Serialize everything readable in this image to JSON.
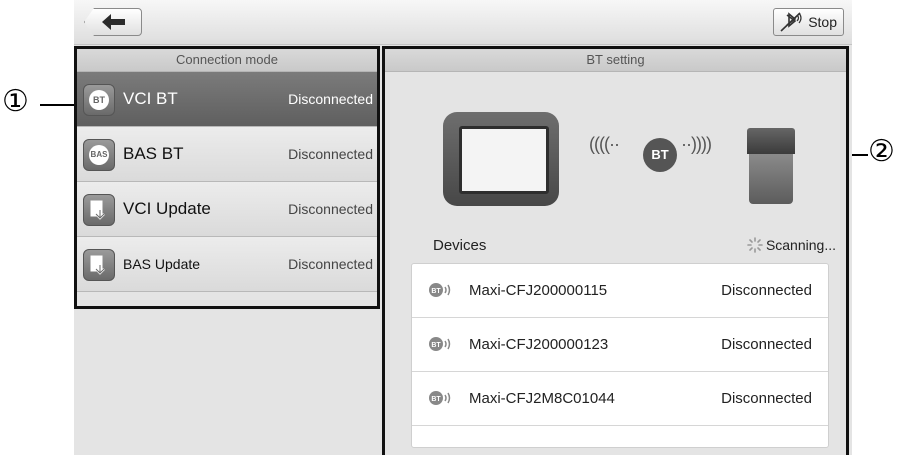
{
  "toolbar": {
    "stop_label": "Stop"
  },
  "left_panel": {
    "header": "Connection mode",
    "items": [
      {
        "badge": "BT",
        "label": "VCI BT",
        "status": "Disconnected",
        "selected": true
      },
      {
        "badge": "BAS",
        "label": "BAS BT",
        "status": "Disconnected",
        "selected": false
      },
      {
        "badge": "",
        "label": "VCI Update",
        "status": "Disconnected",
        "selected": false
      },
      {
        "badge": "",
        "label": "BAS Update",
        "status": "Disconnected",
        "selected": false
      }
    ]
  },
  "right_panel": {
    "header": "BT setting",
    "bt_badge": "BT",
    "devices_label": "Devices",
    "scanning_label": "Scanning...",
    "devices": [
      {
        "name": "Maxi-CFJ200000115",
        "status": "Disconnected"
      },
      {
        "name": "Maxi-CFJ200000123",
        "status": "Disconnected"
      },
      {
        "name": "Maxi-CFJ2M8C01044",
        "status": "Disconnected"
      }
    ]
  },
  "callouts": {
    "left": "①",
    "right": "②"
  }
}
